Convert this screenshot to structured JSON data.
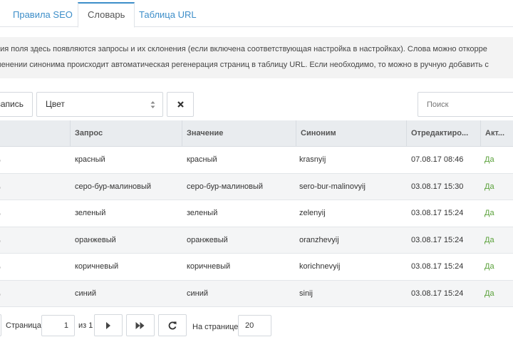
{
  "tabs": [
    {
      "label": "Правила SEO",
      "active": false
    },
    {
      "label": "Словарь",
      "active": true
    },
    {
      "label": "Таблица URL",
      "active": false
    }
  ],
  "info": {
    "line1": "ния поля здесь появляются запросы и их склонения (если включена соответствующая настройка в настройках). Слова можно откорре",
    "line2": "менении синонима происходит автоматическая регенерация страниц в таблицу URL. Если необходимо, то можно в ручную добавить с"
  },
  "toolbar": {
    "add_label": "запись",
    "filter_value": "Цвет",
    "clear_icon": "close-icon",
    "search_placeholder": "Поиск"
  },
  "table": {
    "columns": [
      "Запрос",
      "Значение",
      "Синоним",
      "Отредактиро...",
      "Акт..."
    ],
    "rows": [
      {
        "query": "красный",
        "value": "красный",
        "synonym": "krasnyij",
        "edited": "07.08.17 08:46",
        "active": "Да"
      },
      {
        "query": "серо-бур-малиновый",
        "value": "серо-бур-малиновый",
        "synonym": "sero-bur-malinovyij",
        "edited": "03.08.17 15:30",
        "active": "Да"
      },
      {
        "query": "зеленый",
        "value": "зеленый",
        "synonym": "zelenyij",
        "edited": "03.08.17 15:24",
        "active": "Да"
      },
      {
        "query": "оранжевый",
        "value": "оранжевый",
        "synonym": "oranzhevyij",
        "edited": "03.08.17 15:24",
        "active": "Да"
      },
      {
        "query": "коричневый",
        "value": "коричневый",
        "synonym": "korichnevyij",
        "edited": "03.08.17 15:24",
        "active": "Да"
      },
      {
        "query": "синий",
        "value": "синий",
        "synonym": "sinij",
        "edited": "03.08.17 15:24",
        "active": "Да"
      }
    ]
  },
  "pager": {
    "page_label": "Страница",
    "page_value": "1",
    "of_label": "из 1",
    "per_page_label": "На странице:",
    "per_page_value": "20",
    "next_icon": "chevron-right-icon",
    "last_icon": "double-chevron-right-icon",
    "refresh_icon": "refresh-icon"
  },
  "colors": {
    "accent": "#3d8ec9",
    "active_green": "#5aa13a",
    "header_bg": "#e9ecef",
    "info_bg": "#f3f3f3"
  }
}
